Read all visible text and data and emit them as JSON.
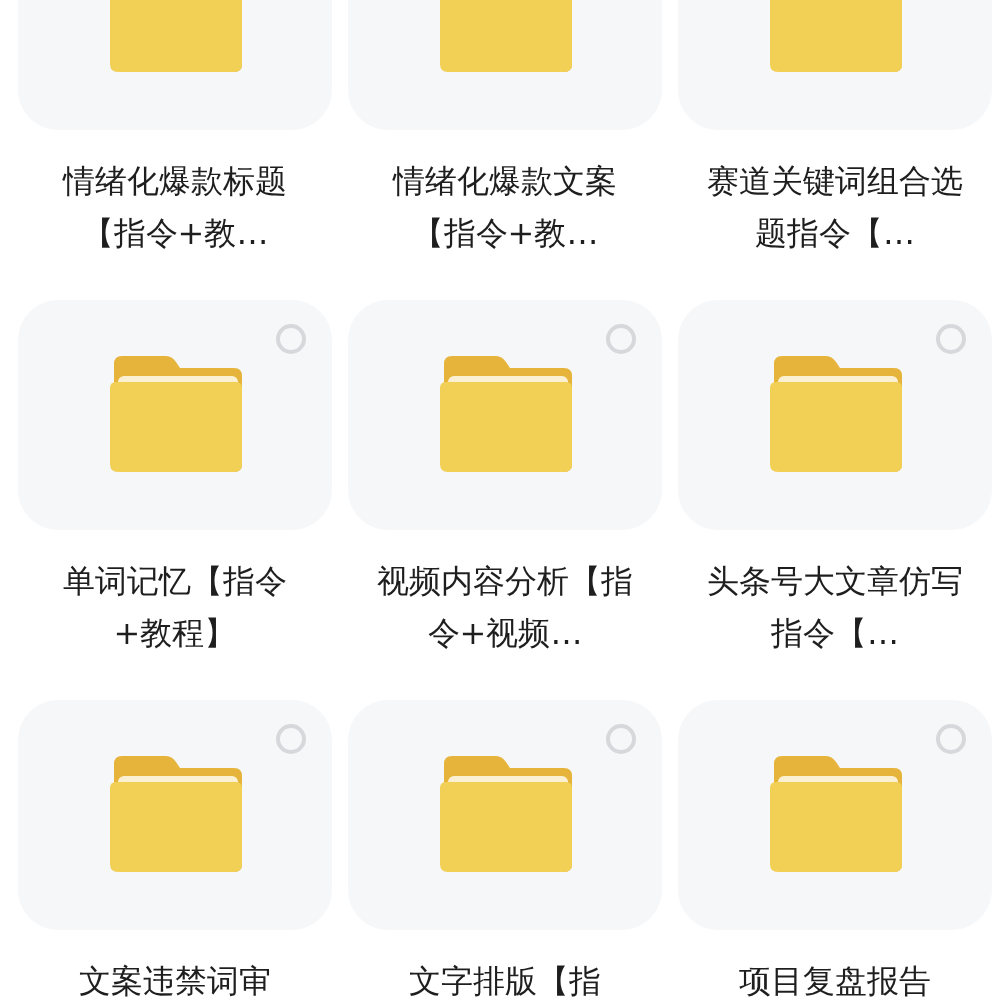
{
  "folders": [
    {
      "title": "情绪化爆款标题【指令+教…"
    },
    {
      "title": "情绪化爆款文案【指令+教…"
    },
    {
      "title": "赛道关键词组合选题指令【…"
    },
    {
      "title": "单词记忆【指令+教程】",
      "selected": false
    },
    {
      "title": "视频内容分析【指令+视频…",
      "selected": false
    },
    {
      "title": "头条号大文章仿写指令【…",
      "selected": false
    },
    {
      "title": "文案违禁词审",
      "selected": false
    },
    {
      "title": "文字排版【指",
      "selected": false
    },
    {
      "title": "项目复盘报告",
      "selected": false
    }
  ]
}
